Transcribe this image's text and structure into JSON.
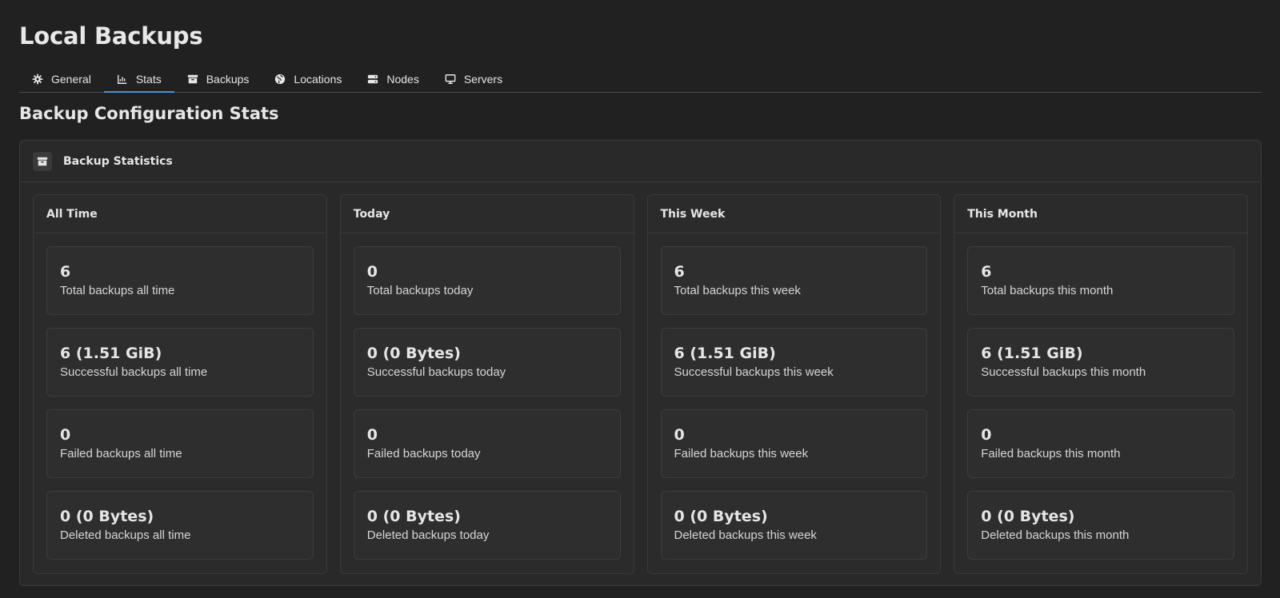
{
  "page": {
    "title": "Local Backups"
  },
  "tabs": [
    {
      "label": "General",
      "icon": "gear-icon",
      "active": false
    },
    {
      "label": "Stats",
      "icon": "chart-icon",
      "active": true
    },
    {
      "label": "Backups",
      "icon": "archive-icon",
      "active": false
    },
    {
      "label": "Locations",
      "icon": "globe-icon",
      "active": false
    },
    {
      "label": "Nodes",
      "icon": "server-icon",
      "active": false
    },
    {
      "label": "Servers",
      "icon": "monitor-icon",
      "active": false
    }
  ],
  "section": {
    "title": "Backup Configuration Stats"
  },
  "panel": {
    "title": "Backup Statistics",
    "icon": "archive-icon"
  },
  "columns": [
    {
      "title": "All Time",
      "stats": [
        {
          "value": "6",
          "label": "Total backups all time"
        },
        {
          "value": "6 (1.51 GiB)",
          "label": "Successful backups all time"
        },
        {
          "value": "0",
          "label": "Failed backups all time"
        },
        {
          "value": "0 (0 Bytes)",
          "label": "Deleted backups all time"
        }
      ]
    },
    {
      "title": "Today",
      "stats": [
        {
          "value": "0",
          "label": "Total backups today"
        },
        {
          "value": "0 (0 Bytes)",
          "label": "Successful backups today"
        },
        {
          "value": "0",
          "label": "Failed backups today"
        },
        {
          "value": "0 (0 Bytes)",
          "label": "Deleted backups today"
        }
      ]
    },
    {
      "title": "This Week",
      "stats": [
        {
          "value": "6",
          "label": "Total backups this week"
        },
        {
          "value": "6 (1.51 GiB)",
          "label": "Successful backups this week"
        },
        {
          "value": "0",
          "label": "Failed backups this week"
        },
        {
          "value": "0 (0 Bytes)",
          "label": "Deleted backups this week"
        }
      ]
    },
    {
      "title": "This Month",
      "stats": [
        {
          "value": "6",
          "label": "Total backups this month"
        },
        {
          "value": "6 (1.51 GiB)",
          "label": "Successful backups this month"
        },
        {
          "value": "0",
          "label": "Failed backups this month"
        },
        {
          "value": "0 (0 Bytes)",
          "label": "Deleted backups this month"
        }
      ]
    }
  ],
  "colors": {
    "background": "#212121",
    "panel": "#292929",
    "accent": "#4f8fd1",
    "text": "#e6e6e6"
  }
}
